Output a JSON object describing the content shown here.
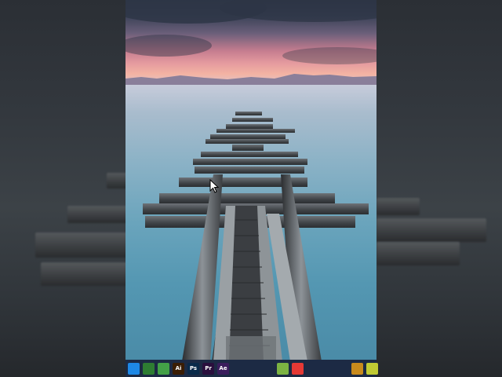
{
  "taskbar": {
    "icons": [
      {
        "name": "files-app-icon",
        "glyph": "",
        "color": "#1e88e5"
      },
      {
        "name": "grid-app-icon",
        "glyph": "",
        "color": "#2e7d32"
      },
      {
        "name": "phone-app-icon",
        "glyph": "",
        "color": "#43a047"
      },
      {
        "name": "illustrator-icon",
        "glyph": "Ai",
        "color": "#3a1d04"
      },
      {
        "name": "photoshop-icon",
        "glyph": "Ps",
        "color": "#0a2a4a"
      },
      {
        "name": "premiere-icon",
        "glyph": "Pr",
        "color": "#2a0f3d"
      },
      {
        "name": "after-effects-icon",
        "glyph": "Ae",
        "color": "#3a1d5c"
      },
      {
        "name": "sketch-app-icon",
        "glyph": "",
        "color": "#1c2a44"
      },
      {
        "name": "resolve-app-icon",
        "glyph": "",
        "color": "#1c2a44"
      },
      {
        "name": "obs-app-icon",
        "glyph": "",
        "color": "#1c2a44"
      },
      {
        "name": "green-app-icon",
        "glyph": "",
        "color": "#7cb342"
      },
      {
        "name": "red-app-icon",
        "glyph": "",
        "color": "#e53935"
      },
      {
        "name": "brave-browser-icon",
        "glyph": "",
        "color": "#1c2a44"
      },
      {
        "name": "chrome-browser-icon",
        "glyph": "",
        "color": "#1c2a44"
      },
      {
        "name": "yellow-app-icon",
        "glyph": "",
        "color": "#1c2a44"
      },
      {
        "name": "orange-app-icon",
        "glyph": "",
        "color": "#c88a1c"
      },
      {
        "name": "partial-app-icon",
        "glyph": "",
        "color": "#c0ca33"
      }
    ]
  }
}
